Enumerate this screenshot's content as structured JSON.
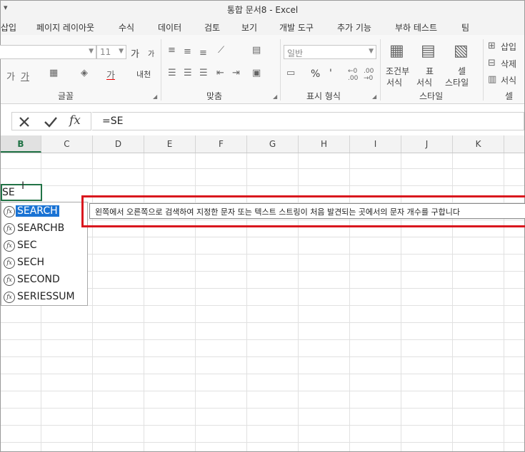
{
  "window": {
    "title": "통합 문서8 - Excel",
    "qat": "▾"
  },
  "tabs": [
    "삽입",
    "페이지 레이아웃",
    "수식",
    "데이터",
    "검토",
    "보기",
    "개발 도구",
    "추가 기능",
    "부하 테스트",
    "팀"
  ],
  "ribbon": {
    "font_size": "11",
    "number_format": "일반",
    "groups": {
      "font": "글꼴",
      "align": "맞춤",
      "number": "표시 형식",
      "styles": "스타일",
      "cells": "셀"
    },
    "styles_buttons": {
      "conditional_1": "조건부",
      "conditional_2": "서식",
      "table_1": "표",
      "table_2": "서식",
      "cell_1": "셀",
      "cell_2": "스타일"
    },
    "cells_buttons": {
      "insert": "삽입",
      "delete": "삭제",
      "format": "서식"
    },
    "misc": {
      "percent": "%",
      "comma": "'",
      "grow": "가",
      "shrink": "가",
      "phonetic": "내천"
    }
  },
  "formula_bar": {
    "value": "=SE"
  },
  "columns": [
    "B",
    "C",
    "D",
    "E",
    "F",
    "G",
    "H",
    "I",
    "J",
    "K"
  ],
  "active_cell": {
    "value": "SE",
    "column": "B"
  },
  "autocomplete": {
    "items": [
      "SEARCH",
      "SEARCHB",
      "SEC",
      "SECH",
      "SECOND",
      "SERIESSUM"
    ],
    "selected_index": 0
  },
  "tooltip": {
    "text": "왼쪽에서 오른쪽으로 검색하여 지정한 문자 또는 텍스트 스트링이 처음 발견되는 곳에서의 문자 개수를 구합니다"
  },
  "colors": {
    "excel_green": "#217346",
    "highlight": "#d9171e",
    "selection": "#1a73d4"
  }
}
